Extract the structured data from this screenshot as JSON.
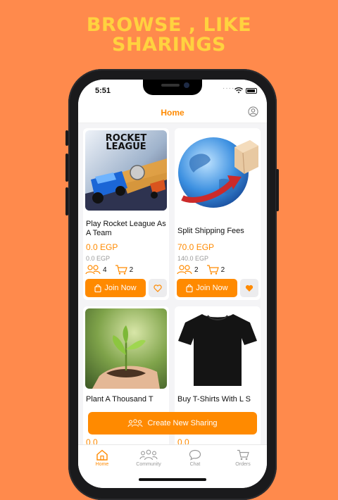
{
  "headline": {
    "line1": "BROWSE , LIKE",
    "line2": "SHARINGS"
  },
  "status_bar": {
    "time": "5:51"
  },
  "nav": {
    "title": "Home"
  },
  "cards": [
    {
      "title": "Play Rocket League As A Team",
      "price": "0.0 EGP",
      "old_price": "0.0 EGP",
      "members": "4",
      "carts": "2",
      "join_label": "Join Now",
      "liked": false,
      "image_logo": "ROCKET LEAGUE"
    },
    {
      "title": "Split Shipping Fees",
      "price": "70.0 EGP",
      "old_price": "140.0 EGP",
      "members": "2",
      "carts": "2",
      "join_label": "Join Now",
      "liked": true
    },
    {
      "title": "Plant A Thousand T",
      "price": "0.0",
      "liked": false
    },
    {
      "title": "Buy T-Shirts With L S",
      "price": "0.0",
      "liked": false
    }
  ],
  "create_button": {
    "label": "Create New Sharing"
  },
  "tabs": [
    {
      "label": "Home",
      "icon": "home-icon",
      "active": true
    },
    {
      "label": "Community",
      "icon": "community-icon",
      "active": false
    },
    {
      "label": "Chat",
      "icon": "chat-icon",
      "active": false
    },
    {
      "label": "Orders",
      "icon": "cart-icon",
      "active": false
    }
  ],
  "colors": {
    "background": "#FF8A4C",
    "headline": "#FFD23F",
    "accent": "#FF8A00",
    "liked_heart": "#FF8A00",
    "unliked_heart": "#FF8A00"
  }
}
